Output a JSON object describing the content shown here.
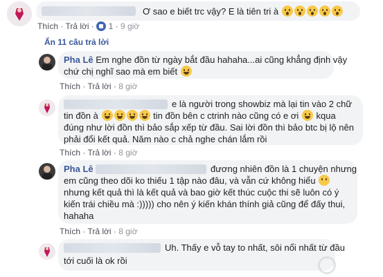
{
  "comments": {
    "top": {
      "text": "Ơ sao e biết trc vậy? E là tiên tri à",
      "emojis": [
        "wow",
        "wow",
        "wow",
        "wow",
        "wow"
      ],
      "like_label": "Thích",
      "reply_label": "Trả lời",
      "like_count": "1",
      "time": "9 giờ"
    },
    "hide_replies_label": "Ẩn 11 câu trả lời",
    "replies": [
      {
        "author": "Pha Lê",
        "line1": "Em nghe đồn từ ngày bắt đầu hahaha...ai cũng khẳng định vậy",
        "line2": "chứ chị nghĩ sao mà em biết",
        "like_label": "Thích",
        "reply_label": "Trả lời",
        "time": "8 giờ"
      },
      {
        "line1": "e là người trong showbiz mà lại tin vào 2 chữ",
        "line2a": "tin đồn à",
        "line2b": "tin đồn bên c ctrinh nào cũng có e ơi",
        "line2c": "kqua",
        "line3": "đúng như lời đồn thì bảo sắp xếp từ đầu. Sai lời đồn thì bảo btc bị lộ nên",
        "line4": "phải đổi kết quả. Năm nào c chả nghe chán lắm rồi",
        "like_label": "Thích",
        "reply_label": "Trả lời",
        "time": "8 giờ"
      },
      {
        "author": "Pha Lê",
        "line1": "đương nhiên đồn là 1 chuyện nhưng",
        "line2": "em cũng theo dõi ko thiếu 1 tập nào đâu, và vẫn cứ không hiểu",
        "line3": "nhưng kết quả thì là kết quả và bao giờ kết thúc cuộc thi sẽ luôn có ý",
        "line4": "kiến trái chiều mà :))))) cho nên ý kiến khán thính giả cũng để đấy thui,",
        "line5": "hahaha",
        "like_label": "Thích",
        "reply_label": "Trả lời",
        "time": "8 giờ"
      },
      {
        "line1": "Uh. Thấy e vỗ tay to nhất, sôi nổi nhất từ đầu",
        "line2": "tới cuối là ok rồi"
      }
    ]
  },
  "colors": {
    "link": "#385898",
    "bubble": "#f2f3f5",
    "meta": "#90949c"
  },
  "icons": [
    "laugh-emoji-icon",
    "wow-emoji-icon",
    "smile-emoji-icon",
    "like-badge-icon",
    "watermark-logo"
  ]
}
